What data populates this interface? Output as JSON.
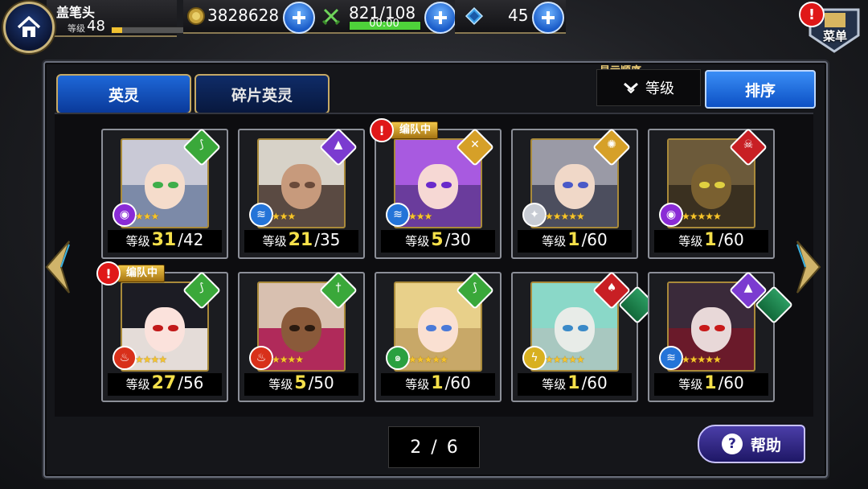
{
  "player": {
    "name": "盖笔头",
    "level_label": "等级",
    "level": "48",
    "xp_fraction": 0.1
  },
  "resources": {
    "gold": "3828628",
    "stamina": "821/108",
    "stamina_timer": "00:00",
    "stamina_fraction": 1.0,
    "crystals": "45"
  },
  "menu": {
    "label": "菜单"
  },
  "tabs": [
    {
      "label": "英灵",
      "active": true
    },
    {
      "label": "碎片英灵",
      "active": false
    }
  ],
  "sort": {
    "title": "显示顺序",
    "selected": "等级",
    "button": "排序"
  },
  "party_tag": "编队中",
  "heroes": [
    {
      "level_label": "等级",
      "level": "31",
      "max": "/42",
      "stars": "★★★",
      "class_icon": "bow-icon",
      "class_color": "#3aa83a",
      "element_icon": "eye-element-icon",
      "element_color": "#8a2bd6",
      "in_party": false,
      "hair": "#c9c9d6",
      "skin": "#f5dccb",
      "bg": "#7c8aa8",
      "eye": "#3fae4a"
    },
    {
      "level_label": "等级",
      "level": "21",
      "max": "/35",
      "stars": "★★★",
      "class_icon": "mage-hat-icon",
      "class_color": "#7b3bd0",
      "element_icon": "water-element-icon",
      "element_color": "#2474d8",
      "in_party": false,
      "hair": "#d7d2c8",
      "skin": "#c79a7c",
      "bg": "#5a4a42",
      "eye": "#6a4a3a"
    },
    {
      "level_label": "等级",
      "level": "5",
      "max": "/30",
      "stars": "★★★",
      "class_icon": "crossbow-icon",
      "class_color": "#d6a028",
      "element_icon": "water-element-icon",
      "element_color": "#2474d8",
      "in_party": true,
      "hair": "#a85ae0",
      "skin": "#f6d8d4",
      "bg": "#6a3c9c",
      "eye": "#6a2acb"
    },
    {
      "level_label": "等级",
      "level": "1",
      "max": "/60",
      "stars": "★★★★★",
      "class_icon": "gear-icon",
      "class_color": "#d6a028",
      "element_icon": "star-element-icon",
      "element_color": "#c8ccd4",
      "in_party": false,
      "hair": "#9a9aa6",
      "skin": "#f0d8c8",
      "bg": "#4c4e5e",
      "eye": "#4a5ac8"
    },
    {
      "level_label": "等级",
      "level": "1",
      "max": "/60",
      "stars": "★★★★★",
      "class_icon": "skull-icon",
      "class_color": "#c81f24",
      "element_icon": "eye-element-icon",
      "element_color": "#8a2bd6",
      "in_party": false,
      "hair": "#6c5a3a",
      "skin": "#7a6030",
      "bg": "#3a3020",
      "eye": "#e0d040"
    },
    {
      "level_label": "等级",
      "level": "27",
      "max": "/56",
      "stars": "★★★★",
      "class_icon": "bow-icon",
      "class_color": "#3aa83a",
      "element_icon": "fire-element-icon",
      "element_color": "#d8301a",
      "in_party": true,
      "hair": "#1c1c24",
      "skin": "#fbe2dc",
      "bg": "#e4dcd8",
      "eye": "#c21a1a"
    },
    {
      "level_label": "等级",
      "level": "5",
      "max": "/50",
      "stars": "★★★★",
      "class_icon": "sword-icon",
      "class_color": "#3aa83a",
      "element_icon": "fire-element-icon",
      "element_color": "#d8301a",
      "in_party": false,
      "hair": "#d8c0b0",
      "skin": "#8a5a3a",
      "bg": "#b02a5a",
      "eye": "#2a1a10"
    },
    {
      "level_label": "等级",
      "level": "1",
      "max": "/60",
      "stars": "★★★★★",
      "class_icon": "bow-icon",
      "class_color": "#3aa83a",
      "element_icon": "wind-element-icon",
      "element_color": "#2aa040",
      "in_party": false,
      "hair": "#e8d08a",
      "skin": "#fae0d2",
      "bg": "#c8a868",
      "eye": "#4a7ad8"
    },
    {
      "level_label": "等级",
      "level": "1",
      "max": "/60",
      "stars": "★★★★★",
      "class_icon": "spade-icon",
      "class_color": "#c81f24",
      "element_icon": "lightning-element-icon",
      "element_color": "#d8b020",
      "in_party": false,
      "hair": "#8ad8c8",
      "skin": "#e8ece8",
      "bg": "#a8c8c0",
      "eye": "#3a8ac8",
      "book": true
    },
    {
      "level_label": "等级",
      "level": "1",
      "max": "/60",
      "stars": "★★★★★",
      "class_icon": "mage-hat-icon",
      "class_color": "#7b3bd0",
      "element_icon": "water-element-icon",
      "element_color": "#2474d8",
      "in_party": false,
      "hair": "#3a2a3a",
      "skin": "#e8d8d8",
      "bg": "#6a1a2a",
      "eye": "#c81a1a",
      "book": true
    }
  ],
  "pager": {
    "current": "2",
    "sep": "/",
    "total": "6"
  },
  "help": {
    "label": "帮助",
    "icon": "?"
  }
}
